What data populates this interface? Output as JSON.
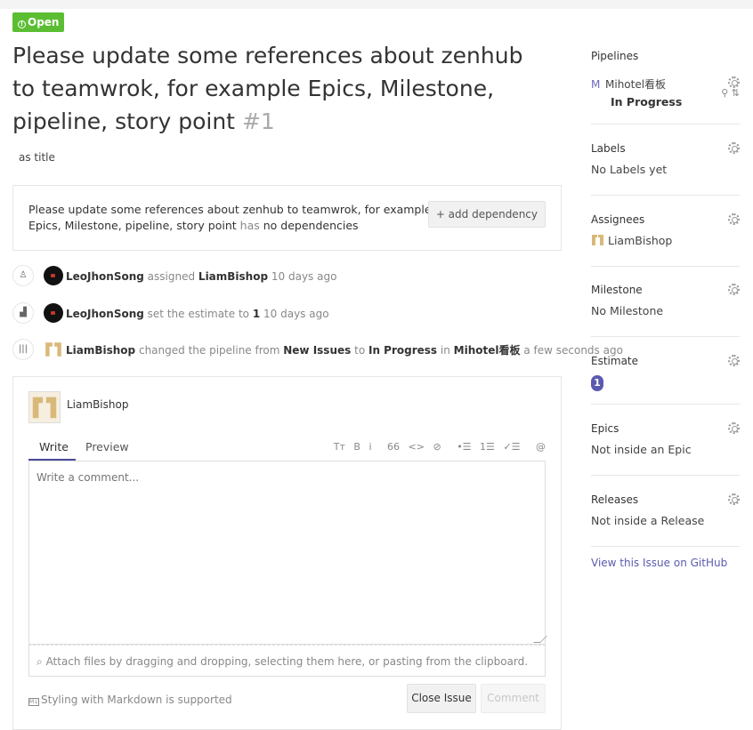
{
  "issue": {
    "status_label": "Open",
    "title": "Please update some references about zenhub to teamwrok, for example Epics, Milestone, pipeline, story point",
    "number": "#1",
    "body": "as title"
  },
  "dependencies": {
    "issue_title": "Please update some references about zenhub to teamwrok, for example Epics, Milestone, pipeline, story point",
    "has": "has",
    "none": "no dependencies",
    "add_button": "+ add dependency"
  },
  "timeline": [
    {
      "icon": "person-icon",
      "user": "LeoJhonSong",
      "action": "assigned",
      "target": "LiamBishop",
      "time": "10 days ago"
    },
    {
      "icon": "chart-icon",
      "user": "LeoJhonSong",
      "action": "set the estimate to",
      "target": "1",
      "time": "10 days ago"
    },
    {
      "icon": "columns-icon",
      "user": "LiamBishop",
      "action": "changed the pipeline from",
      "from": "New Issues",
      "to_word": "to",
      "to": "In Progress",
      "in_word": "in",
      "board": "Mihotel看板",
      "time": "a few seconds ago"
    }
  ],
  "comment": {
    "user": "LiamBishop",
    "tab_write": "Write",
    "tab_preview": "Preview",
    "toolbar": [
      "Tт",
      "B",
      "i",
      "66",
      "<>",
      "⊘",
      "•☰",
      "1☰",
      "✓☰",
      "@"
    ],
    "placeholder": "Write a comment...",
    "attach_hint": "Attach files by dragging and dropping, selecting them here, or pasting from the clipboard.",
    "markdown_note": "Styling with Markdown is supported",
    "close_button": "Close Issue",
    "comment_button": "Comment"
  },
  "sidebar": {
    "pipelines": {
      "head": "Pipelines",
      "board_letter": "M",
      "board": "Mihotel看板",
      "stage": "In Progress"
    },
    "labels": {
      "head": "Labels",
      "value": "No Labels yet"
    },
    "assignees": {
      "head": "Assignees",
      "value": "LiamBishop"
    },
    "milestone": {
      "head": "Milestone",
      "value": "No Milestone"
    },
    "estimate": {
      "head": "Estimate",
      "value": "1"
    },
    "epics": {
      "head": "Epics",
      "value": "Not inside an Epic"
    },
    "releases": {
      "head": "Releases",
      "value": "Not inside a Release"
    },
    "github_link": "View this Issue on GitHub"
  },
  "colors": {
    "open_badge": "#5bbe32",
    "accent": "#5a5ab0"
  }
}
